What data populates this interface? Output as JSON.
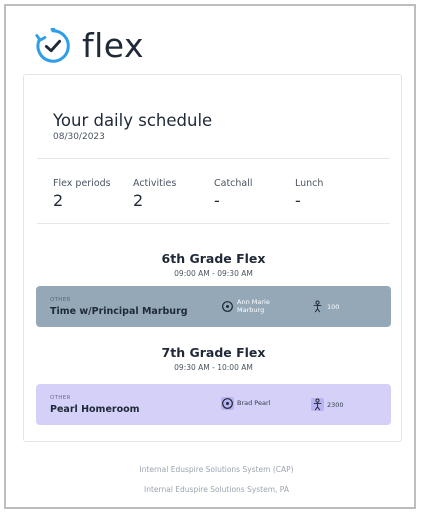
{
  "brand": {
    "name": "flex",
    "icon": "stopwatch-check-icon",
    "accent": "#2f9ee8"
  },
  "schedule": {
    "title": "Your daily schedule",
    "date": "08/30/2023",
    "stats": [
      {
        "label": "Flex periods",
        "value": "2"
      },
      {
        "label": "Activities",
        "value": "2"
      },
      {
        "label": "Catchall",
        "value": "-"
      },
      {
        "label": "Lunch",
        "value": "-"
      }
    ],
    "periods": [
      {
        "title": "6th Grade Flex",
        "time": "09:00 AM - 09:30 AM",
        "activity": {
          "category": "OTHER",
          "name": "Time w/Principal Marburg",
          "teacher": "Ann Marie Marburg",
          "teacher_icon": "location-pin-icon",
          "room": "100",
          "room_icon": "person-icon",
          "color": "#94a8b8"
        }
      },
      {
        "title": "7th Grade Flex",
        "time": "09:30 AM - 10:00 AM",
        "activity": {
          "category": "OTHER",
          "name": "Pearl Homeroom",
          "teacher": "Brad Pearl",
          "teacher_icon": "location-pin-icon",
          "room": "2300",
          "room_icon": "person-icon",
          "color": "#d4d0f7"
        }
      }
    ]
  },
  "footer": {
    "line1": "Internal Eduspire Solutions System (CAP)",
    "line2": "Internal Eduspire Solutions System, PA"
  }
}
